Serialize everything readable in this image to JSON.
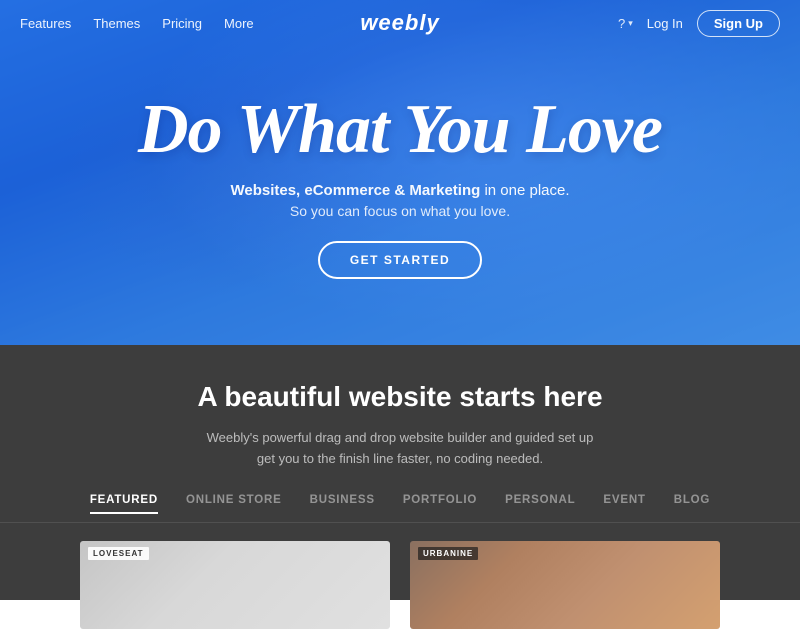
{
  "navbar": {
    "links": [
      {
        "label": "Features",
        "id": "features"
      },
      {
        "label": "Themes",
        "id": "themes"
      },
      {
        "label": "Pricing",
        "id": "pricing"
      },
      {
        "label": "More",
        "id": "more"
      }
    ],
    "logo": "weebly",
    "help_label": "?",
    "login_label": "Log In",
    "signup_label": "Sign Up"
  },
  "hero": {
    "headline_line1": "Do What You Love",
    "subtext_bold": "Websites, eCommerce & Marketing",
    "subtext_normal": " in one place.",
    "subtext_2": "So you can focus on what you love.",
    "cta_label": "GET STARTED"
  },
  "lower": {
    "title": "A beautiful website starts here",
    "desc_line1": "Weebly's powerful drag and drop website builder and guided set up",
    "desc_line2": "get you to the finish line faster, no coding needed.",
    "tabs": [
      {
        "label": "FEATURED",
        "active": true
      },
      {
        "label": "ONLINE STORE",
        "active": false
      },
      {
        "label": "BUSINESS",
        "active": false
      },
      {
        "label": "PORTFOLIO",
        "active": false
      },
      {
        "label": "PERSONAL",
        "active": false
      },
      {
        "label": "EVENT",
        "active": false
      },
      {
        "label": "BLOG",
        "active": false
      }
    ],
    "cards": [
      {
        "label": "LOVESEAT",
        "style": "light"
      },
      {
        "label": "URBANINE",
        "style": "dark"
      }
    ]
  }
}
